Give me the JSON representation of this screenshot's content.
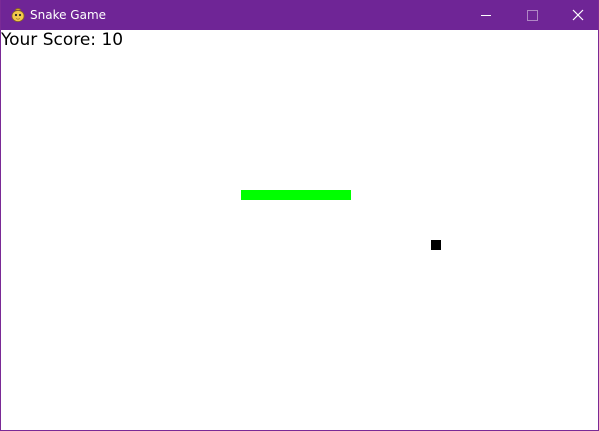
{
  "window": {
    "title": "Snake Game",
    "titlebar_color": "#6f2596",
    "app_icon": "pygame-snake-icon"
  },
  "controls": {
    "minimize_icon": "minimize-icon",
    "maximize_icon": "maximize-icon",
    "close_icon": "close-icon"
  },
  "game": {
    "score_text": "Your Score: 10",
    "score": 10,
    "snake_color": "#00ff00",
    "food_color": "#000000",
    "background_color": "#ffffff",
    "snake_length": 11
  }
}
